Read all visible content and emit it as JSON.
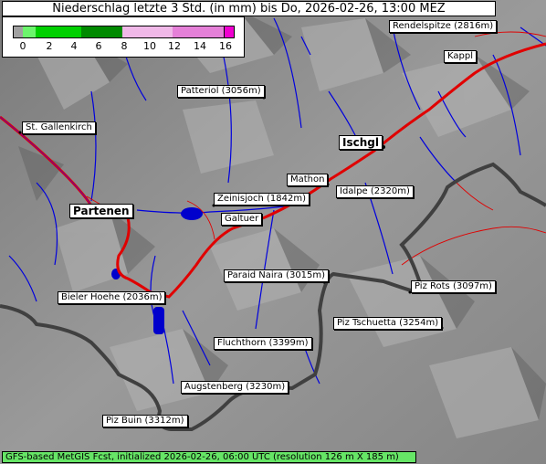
{
  "title": "Niederschlag letzte 3 Std. (in mm) bis Do, 2026-02-26, 13:00 MEZ",
  "legend": {
    "ticks": [
      "0",
      "2",
      "4",
      "6",
      "8",
      "10",
      "12",
      "14",
      "16"
    ],
    "colors": [
      "#a0a0a0",
      "#6cf56c",
      "#00d000",
      "#00a000",
      "#008000",
      "#f0b8e8",
      "#e890dc",
      "#e070d0",
      "#f000d0"
    ]
  },
  "places": [
    {
      "name": "Rendelspitze (2816m)"
    },
    {
      "name": "Kappl"
    },
    {
      "name": "Patteriol (3056m)"
    },
    {
      "name": "St. Gallenkirch"
    },
    {
      "name": "Ischgl"
    },
    {
      "name": "Mathon"
    },
    {
      "name": "Idalpe (2320m)"
    },
    {
      "name": "Zeinisjoch (1842m)"
    },
    {
      "name": "Partenen"
    },
    {
      "name": "Galtuer"
    },
    {
      "name": "Paraid Naira (3015m)"
    },
    {
      "name": "Piz Rots (3097m)"
    },
    {
      "name": "Bieler Hoehe (2036m)"
    },
    {
      "name": "Piz Tschuetta (3254m)"
    },
    {
      "name": "Fluchthorn (3399m)"
    },
    {
      "name": "Augstenberg (3230m)"
    },
    {
      "name": "Piz Buin (3312m)"
    }
  ],
  "footer": "GFS-based MetGIS Fcst, initialized 2026-02-26, 06:00 UTC  (resolution 126 m X 185 m)",
  "colors": {
    "road": "#e00000",
    "river": "#0000dd",
    "border": "#404040",
    "lake": "#0000cc"
  }
}
